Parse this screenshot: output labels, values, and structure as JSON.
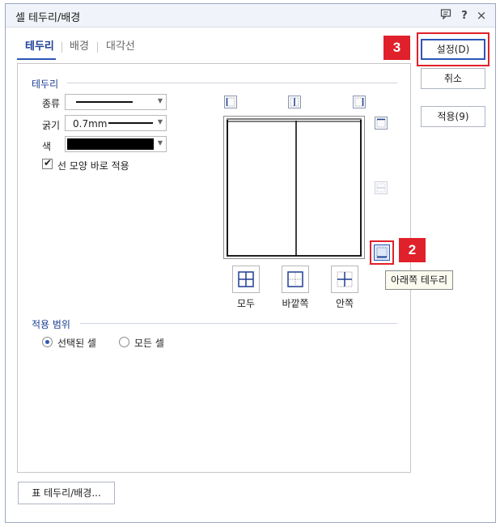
{
  "window": {
    "title": "셀 테두리/배경",
    "help_symbol": "?",
    "close_symbol": "×"
  },
  "tabs": [
    {
      "label": "테두리",
      "active": true
    },
    {
      "label": "배경",
      "active": false
    },
    {
      "label": "대각선",
      "active": false
    }
  ],
  "border_section": {
    "title": "테두리",
    "type_label": "종류",
    "thickness_label": "굵기",
    "thickness_value": "0.7mm",
    "color_label": "색",
    "color_value": "#000000",
    "apply_shape_label": "선 모양 바로 적용",
    "apply_shape_checked": true
  },
  "presets": [
    {
      "label": "모두"
    },
    {
      "label": "바깥쪽"
    },
    {
      "label": "안쪽"
    }
  ],
  "tooltip": "아래쪽 테두리",
  "scope_section": {
    "title": "적용 범위",
    "options": [
      {
        "label": "선택된 셀",
        "selected": true
      },
      {
        "label": "모든 셀",
        "selected": false
      }
    ]
  },
  "buttons": {
    "ok": "설정(D)",
    "cancel": "취소",
    "apply": "적용(9)",
    "table_border": "표 테두리/배경..."
  },
  "annotations": {
    "step2": "2",
    "step3": "3",
    "accent_color": "#e0202a"
  }
}
